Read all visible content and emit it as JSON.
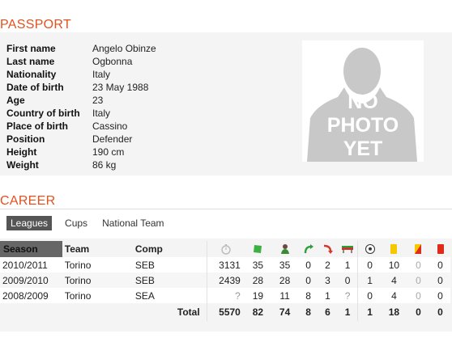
{
  "passport": {
    "title": "PASSPORT",
    "fields": [
      {
        "label": "First name",
        "value": "Angelo Obinze"
      },
      {
        "label": "Last name",
        "value": "Ogbonna"
      },
      {
        "label": "Nationality",
        "value": "Italy"
      },
      {
        "label": "Date of birth",
        "value": "23 May 1988"
      },
      {
        "label": "Age",
        "value": "23"
      },
      {
        "label": "Country of birth",
        "value": "Italy"
      },
      {
        "label": "Place of birth",
        "value": "Cassino"
      },
      {
        "label": "Position",
        "value": "Defender"
      },
      {
        "label": "Height",
        "value": "190 cm"
      },
      {
        "label": "Weight",
        "value": "86 kg"
      }
    ],
    "photo_text": [
      "NO",
      "PHOTO",
      "YET"
    ]
  },
  "career": {
    "title": "CAREER",
    "tabs": [
      "Leagues",
      "Cups",
      "National Team"
    ],
    "active_tab": "Leagues",
    "columns": {
      "season": "Season",
      "team": "Team",
      "comp": "Comp",
      "icons": [
        "minutes-icon",
        "appearances-icon",
        "lineups-icon",
        "sub-in-icon",
        "sub-out-icon",
        "bench-icon",
        "goals-icon",
        "yellow-card-icon",
        "yellow-red-card-icon",
        "red-card-icon"
      ]
    },
    "rows": [
      {
        "season": "2010/2011",
        "team": "Torino",
        "comp": "SEB",
        "minutes": "3131",
        "apps": "35",
        "lineups": "35",
        "sub_in": "0",
        "sub_out": "2",
        "bench": "1",
        "goals": "0",
        "yellow": "10",
        "yellow_red": "0",
        "red": "0"
      },
      {
        "season": "2009/2010",
        "team": "Torino",
        "comp": "SEB",
        "minutes": "2439",
        "apps": "28",
        "lineups": "28",
        "sub_in": "0",
        "sub_out": "3",
        "bench": "0",
        "goals": "1",
        "yellow": "4",
        "yellow_red": "0",
        "red": "0"
      },
      {
        "season": "2008/2009",
        "team": "Torino",
        "comp": "SEA",
        "minutes": "?",
        "apps": "19",
        "lineups": "11",
        "sub_in": "8",
        "sub_out": "1",
        "bench": "?",
        "goals": "0",
        "yellow": "4",
        "yellow_red": "0",
        "red": "0"
      }
    ],
    "total": {
      "label": "Total",
      "minutes": "5570",
      "apps": "82",
      "lineups": "74",
      "sub_in": "8",
      "sub_out": "6",
      "bench": "1",
      "goals": "1",
      "yellow": "18",
      "yellow_red": "0",
      "red": "0"
    }
  },
  "colors": {
    "accent": "#e0521f",
    "panel": "#f4f4f4",
    "tab_active": "#555555"
  }
}
